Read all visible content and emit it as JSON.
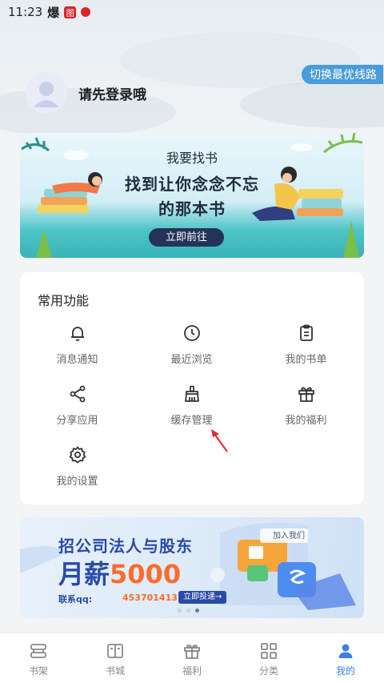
{
  "status_bar": {
    "time": "11:23",
    "glyph": "爆",
    "badge": "图"
  },
  "header": {
    "switch_route_label": "切换最优线路",
    "login_prompt": "请先登录哦"
  },
  "banner_find_book": {
    "title": "我要找书",
    "line1": "找到让你念念不忘",
    "line2": "的那本书",
    "button": "立即前往"
  },
  "functions": {
    "title": "常用功能",
    "items": [
      {
        "label": "消息通知",
        "icon": "bell-icon"
      },
      {
        "label": "最近浏览",
        "icon": "clock-icon"
      },
      {
        "label": "我的书单",
        "icon": "clipboard-icon"
      },
      {
        "label": "分享应用",
        "icon": "share-icon"
      },
      {
        "label": "缓存管理",
        "icon": "broom-icon"
      },
      {
        "label": "我的福利",
        "icon": "gift-icon"
      },
      {
        "label": "我的设置",
        "icon": "gear-icon"
      }
    ]
  },
  "banner_recruit": {
    "headline": "招公司法人与股东",
    "salary_prefix": "月薪",
    "salary_num": "5000",
    "contact_label": "联系qq:",
    "contact_qq": "453701413",
    "cta": "立即投递→",
    "tag": "加入我们"
  },
  "tabbar": {
    "items": [
      {
        "label": "书架",
        "icon": "bookshelf-icon"
      },
      {
        "label": "书城",
        "icon": "book-icon"
      },
      {
        "label": "福利",
        "icon": "gift-icon"
      },
      {
        "label": "分类",
        "icon": "grid-icon"
      },
      {
        "label": "我的",
        "icon": "user-icon"
      }
    ],
    "active": "我的"
  },
  "colors": {
    "accent": "#3d7fe0",
    "switch_bg": "#4a9bd9",
    "banner_button": "#24335a"
  }
}
